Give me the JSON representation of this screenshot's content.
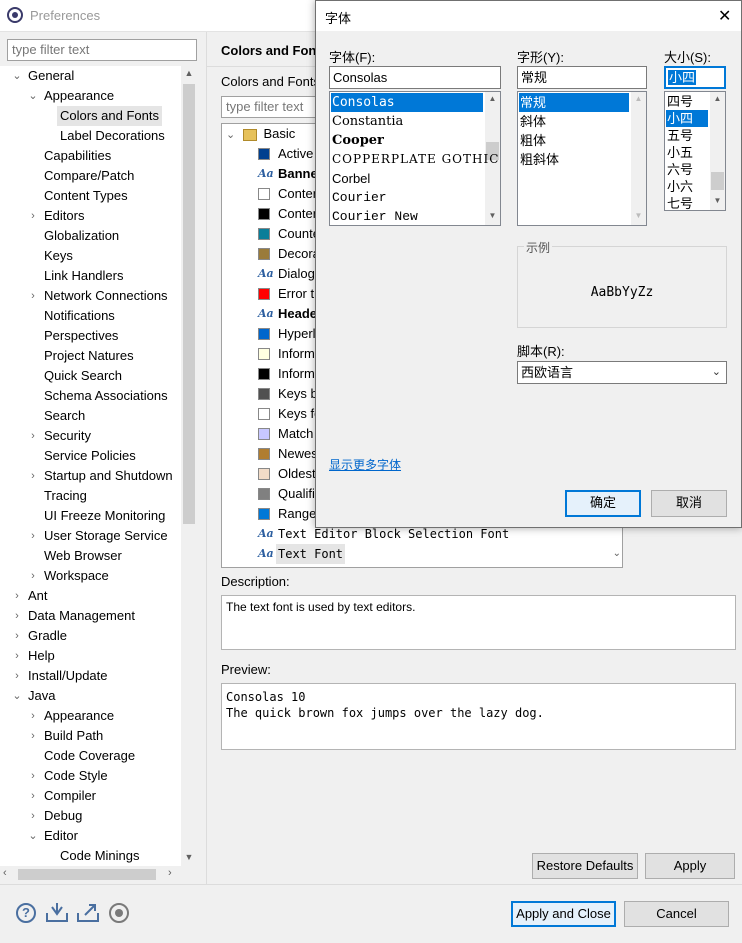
{
  "window": {
    "title": "Preferences"
  },
  "sidebar": {
    "filter_placeholder": "type filter text",
    "items": [
      {
        "label": "General",
        "tw": "⌄",
        "indent": 0
      },
      {
        "label": "Appearance",
        "tw": "⌄",
        "indent": 1
      },
      {
        "label": "Colors and Fonts",
        "tw": "",
        "indent": 2,
        "selected": true
      },
      {
        "label": "Label Decorations",
        "tw": "",
        "indent": 2
      },
      {
        "label": "Capabilities",
        "tw": "",
        "indent": 1
      },
      {
        "label": "Compare/Patch",
        "tw": "",
        "indent": 1
      },
      {
        "label": "Content Types",
        "tw": "",
        "indent": 1
      },
      {
        "label": "Editors",
        "tw": "›",
        "indent": 1
      },
      {
        "label": "Globalization",
        "tw": "",
        "indent": 1
      },
      {
        "label": "Keys",
        "tw": "",
        "indent": 1
      },
      {
        "label": "Link Handlers",
        "tw": "",
        "indent": 1
      },
      {
        "label": "Network Connections",
        "tw": "›",
        "indent": 1
      },
      {
        "label": "Notifications",
        "tw": "",
        "indent": 1
      },
      {
        "label": "Perspectives",
        "tw": "",
        "indent": 1
      },
      {
        "label": "Project Natures",
        "tw": "",
        "indent": 1
      },
      {
        "label": "Quick Search",
        "tw": "",
        "indent": 1
      },
      {
        "label": "Schema Associations",
        "tw": "",
        "indent": 1
      },
      {
        "label": "Search",
        "tw": "",
        "indent": 1
      },
      {
        "label": "Security",
        "tw": "›",
        "indent": 1
      },
      {
        "label": "Service Policies",
        "tw": "",
        "indent": 1
      },
      {
        "label": "Startup and Shutdown",
        "tw": "›",
        "indent": 1
      },
      {
        "label": "Tracing",
        "tw": "",
        "indent": 1
      },
      {
        "label": "UI Freeze Monitoring",
        "tw": "",
        "indent": 1
      },
      {
        "label": "User Storage Service",
        "tw": "›",
        "indent": 1
      },
      {
        "label": "Web Browser",
        "tw": "",
        "indent": 1
      },
      {
        "label": "Workspace",
        "tw": "›",
        "indent": 1
      },
      {
        "label": "Ant",
        "tw": "›",
        "indent": 0
      },
      {
        "label": "Data Management",
        "tw": "›",
        "indent": 0
      },
      {
        "label": "Gradle",
        "tw": "›",
        "indent": 0
      },
      {
        "label": "Help",
        "tw": "›",
        "indent": 0
      },
      {
        "label": "Install/Update",
        "tw": "›",
        "indent": 0
      },
      {
        "label": "Java",
        "tw": "⌄",
        "indent": 0
      },
      {
        "label": "Appearance",
        "tw": "›",
        "indent": 1
      },
      {
        "label": "Build Path",
        "tw": "›",
        "indent": 1
      },
      {
        "label": "Code Coverage",
        "tw": "",
        "indent": 1
      },
      {
        "label": "Code Style",
        "tw": "›",
        "indent": 1
      },
      {
        "label": "Compiler",
        "tw": "›",
        "indent": 1
      },
      {
        "label": "Debug",
        "tw": "›",
        "indent": 1
      },
      {
        "label": "Editor",
        "tw": "⌄",
        "indent": 1
      },
      {
        "label": "Code Minings",
        "tw": "",
        "indent": 2
      }
    ]
  },
  "panel": {
    "title": "Colors and Fonts",
    "subtitle": "Colors and Fonts",
    "filter_placeholder": "type filter text",
    "tree_root": "Basic",
    "tree_items": [
      {
        "label": "Active",
        "kind": "color",
        "color": "#003f8f"
      },
      {
        "label": "Banner",
        "kind": "font",
        "bold": true
      },
      {
        "label": "Conter",
        "kind": "color",
        "color": "#ffffff"
      },
      {
        "label": "Conter",
        "kind": "color",
        "color": "#000000"
      },
      {
        "label": "Counte",
        "kind": "color",
        "color": "#0a7e99"
      },
      {
        "label": "Decora",
        "kind": "color",
        "color": "#9a7b3a"
      },
      {
        "label": "Dialog",
        "kind": "font"
      },
      {
        "label": "Error t",
        "kind": "color",
        "color": "#ff0000"
      },
      {
        "label": "Heade",
        "kind": "font",
        "bold": true
      },
      {
        "label": "Hyperl",
        "kind": "color",
        "color": "#0066cc"
      },
      {
        "label": "Inform",
        "kind": "color",
        "color": "#ffffe1"
      },
      {
        "label": "Inform",
        "kind": "color",
        "color": "#000000"
      },
      {
        "label": "Keys b",
        "kind": "color",
        "color": "#505050"
      },
      {
        "label": "Keys fo",
        "kind": "color",
        "color": "#ffffff"
      },
      {
        "label": "Match",
        "kind": "color",
        "color": "#c8c8ff"
      },
      {
        "label": "Newes",
        "kind": "color",
        "color": "#b07d30"
      },
      {
        "label": "Oldest",
        "kind": "color",
        "color": "#f2dcc8"
      },
      {
        "label": "Qualifi",
        "kind": "color",
        "color": "#808080"
      },
      {
        "label": "Range",
        "kind": "color",
        "color": "#0078d7"
      },
      {
        "label": "Text Editor Block Selection Font",
        "kind": "font",
        "mono": true
      },
      {
        "label": "Text Font",
        "kind": "font",
        "mono": true,
        "selected": true
      }
    ],
    "description_label": "Description:",
    "description_text": "The text font is used by text editors.",
    "preview_label": "Preview:",
    "preview_line1": "Consolas 10",
    "preview_line2": "The quick brown fox jumps over the lazy dog.",
    "restore_defaults": "Restore Defaults",
    "apply": "Apply"
  },
  "footer": {
    "apply_and_close": "Apply and Close",
    "cancel": "Cancel",
    "icons": [
      "help-icon",
      "import-icon",
      "export-icon",
      "record-icon"
    ]
  },
  "font_dialog": {
    "title": "字体",
    "font_label": "字体(F):",
    "font_value": "Consolas",
    "fonts": [
      "Consolas",
      "Constantia",
      "Cooper",
      "COPPERPLATE GOTHIC",
      "Corbel",
      "Courier",
      "Courier New"
    ],
    "style_label": "字形(Y):",
    "style_value": "常规",
    "styles": [
      "常规",
      "斜体",
      "粗体",
      "粗斜体"
    ],
    "size_label": "大小(S):",
    "size_value": "小四",
    "sizes": [
      "四号",
      "小四",
      "五号",
      "小五",
      "六号",
      "小六",
      "七号"
    ],
    "sample_label": "示例",
    "sample_text": "AaBbYyZz",
    "script_label": "脚本(R):",
    "script_value": "西欧语言",
    "more_fonts": "显示更多字体",
    "ok": "确定",
    "cancel": "取消",
    "close_glyph": "✕"
  }
}
